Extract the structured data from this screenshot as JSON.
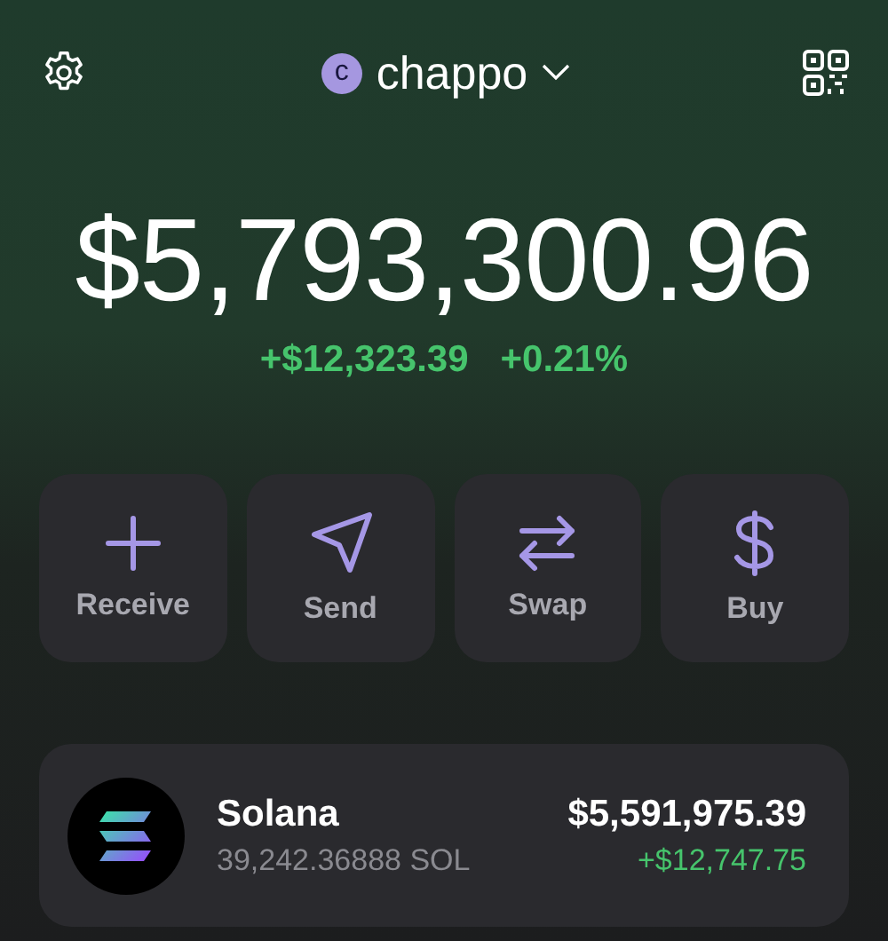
{
  "account": {
    "avatar_letter": "c",
    "name": "chappo"
  },
  "balance": {
    "total": "$5,793,300.96",
    "change": "+$12,323.39",
    "change_percent": "+0.21%"
  },
  "actions": [
    {
      "kind": "plus",
      "label": "Receive"
    },
    {
      "kind": "send",
      "label": "Send"
    },
    {
      "kind": "swap",
      "label": "Swap"
    },
    {
      "kind": "dollar",
      "label": "Buy"
    }
  ],
  "tokens": [
    {
      "name": "Solana",
      "amount": "39,242.36888 SOL",
      "value": "$5,591,975.39",
      "change": "+$12,747.75"
    }
  ]
}
